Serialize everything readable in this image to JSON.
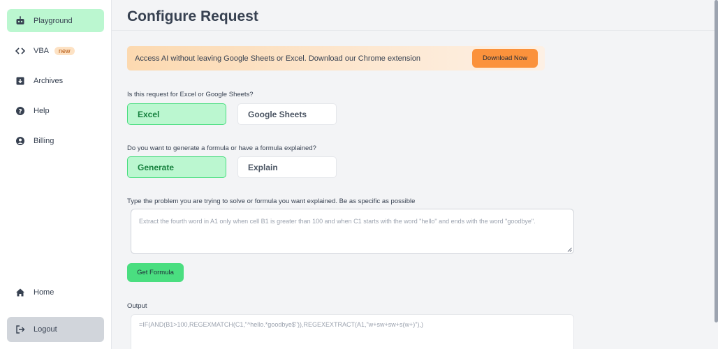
{
  "sidebar": {
    "items": [
      {
        "label": "Playground",
        "icon": "robot-icon"
      },
      {
        "label": "VBA",
        "icon": "code-icon",
        "badge": "new"
      },
      {
        "label": "Archives",
        "icon": "archive-icon"
      },
      {
        "label": "Help",
        "icon": "help-icon"
      },
      {
        "label": "Billing",
        "icon": "user-circle-icon"
      }
    ],
    "home": {
      "label": "Home",
      "icon": "home-icon"
    },
    "logout": {
      "label": "Logout",
      "icon": "logout-icon"
    }
  },
  "header": {
    "title": "Configure Request"
  },
  "banner": {
    "text": "Access AI without leaving Google Sheets or Excel. Download our Chrome extension",
    "button": "Download Now"
  },
  "platform": {
    "question": "Is this request for Excel or Google Sheets?",
    "options": [
      "Excel",
      "Google Sheets"
    ],
    "selected": "Excel"
  },
  "mode": {
    "question": "Do you want to generate a formula or have a formula explained?",
    "options": [
      "Generate",
      "Explain"
    ],
    "selected": "Generate"
  },
  "problem": {
    "label": "Type the problem you are trying to solve or formula you want explained. Be as specific as possible",
    "placeholder": "Extract the fourth word in A1 only when cell B1 is greater than 100 and when C1 starts with the word \"hello\" and ends with the word \"goodbye\"."
  },
  "get_formula_button": "Get Formula",
  "output": {
    "label": "Output",
    "value": "=IF(AND(B1>100,REGEXMATCH(C1,\"^hello.*goodbye$\")),REGEXEXTRACT(A1,\"w+sw+sw+s(w+)\"),)"
  },
  "colors": {
    "accent_green": "#4ade80",
    "selected_bg": "#bbf7d0",
    "banner_button": "#fb923c"
  }
}
